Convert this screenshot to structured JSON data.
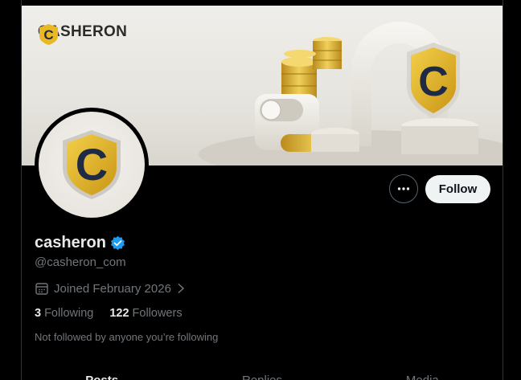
{
  "banner": {
    "brand_name": "CASHERON",
    "logo_letter": "C",
    "brand_colors": {
      "gold": "#e8b923",
      "navy": "#1f2a44"
    }
  },
  "profile": {
    "display_name": "casheron",
    "verified": true,
    "handle": "@casheron_com",
    "joined": "Joined February 2026",
    "following_count": "3",
    "following_label": "Following",
    "followers_count": "122",
    "followers_label": "Followers",
    "not_followed_text": "Not followed by anyone you’re following"
  },
  "actions": {
    "follow_label": "Follow",
    "more_icon": "more-horizontal-icon"
  },
  "tabs": [
    {
      "label": "Posts",
      "active": true
    },
    {
      "label": "Replies",
      "active": false
    },
    {
      "label": "Media",
      "active": false
    }
  ],
  "colors": {
    "background": "#000000",
    "text_primary": "#e7e9ea",
    "text_secondary": "#71767b",
    "verified_blue": "#1d9bf0",
    "follow_bg": "#eff3f4"
  }
}
